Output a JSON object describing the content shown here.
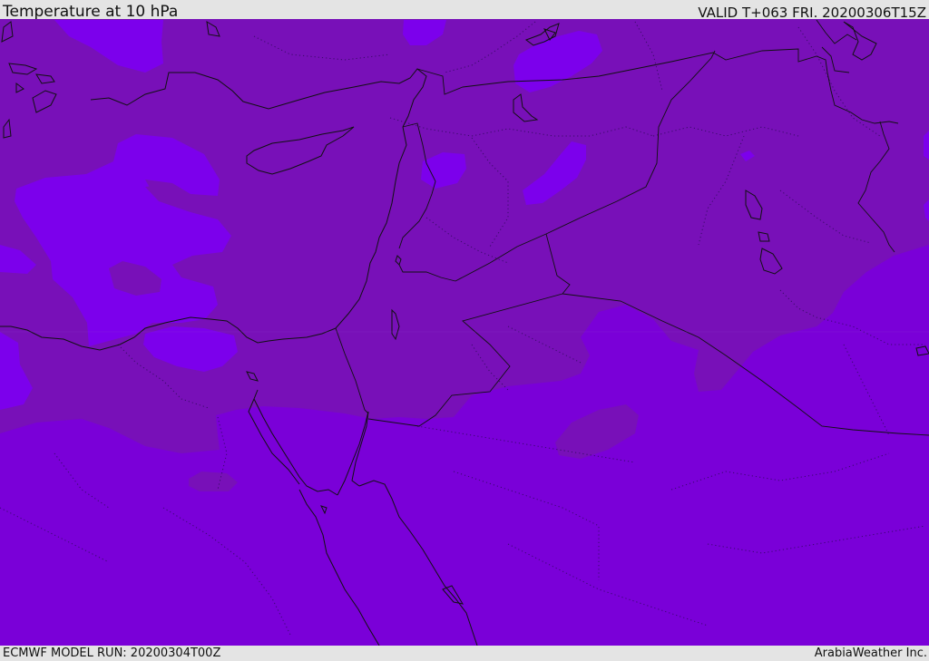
{
  "header": {
    "title": "Temperature at 10 hPa",
    "valid": "VALID T+063 FRI. 20200306T15Z"
  },
  "footer": {
    "model_run": "ECMWF MODEL RUN: 20200304T00Z",
    "credit": "ArabiaWeather Inc."
  },
  "map": {
    "colors": {
      "warm_band": "#7810b8",
      "cool_band": "#7a00d8",
      "light_patch": "#7c00ec",
      "coast": "#111111"
    }
  }
}
